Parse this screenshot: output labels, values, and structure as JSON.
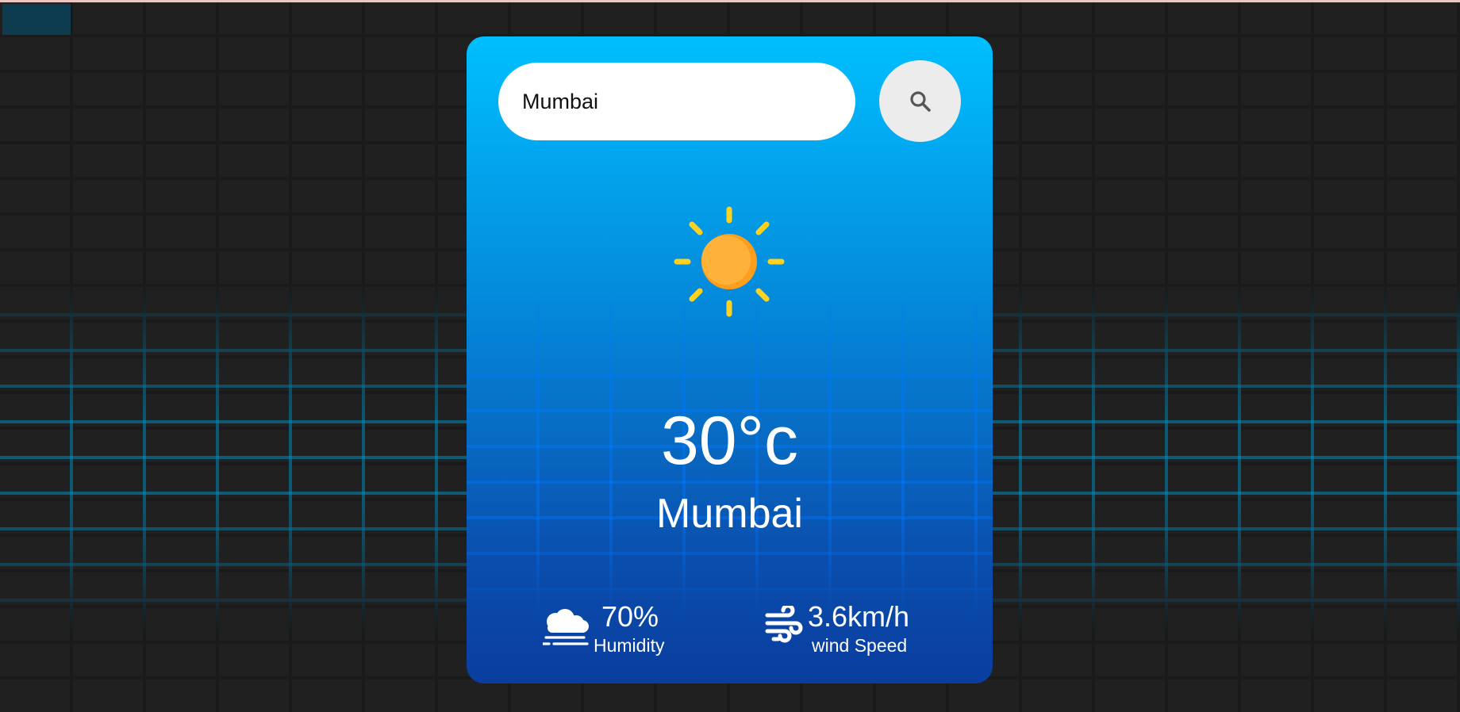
{
  "search": {
    "value": "Mumbai",
    "icon": "search-icon"
  },
  "weather": {
    "icon": "sun-icon",
    "temperature": "30°c",
    "city": "Mumbai"
  },
  "humidity": {
    "icon": "humidity-cloud-icon",
    "value": "70%",
    "label": "Humidity"
  },
  "wind": {
    "icon": "wind-icon",
    "value": "3.6km/h",
    "label": "wind Speed"
  },
  "colors": {
    "card_top": "#00bfff",
    "card_bottom": "#0a3d9e",
    "sun_rays": "#ffd21f",
    "sun_core": "#ffb23a",
    "background": "#222222"
  }
}
